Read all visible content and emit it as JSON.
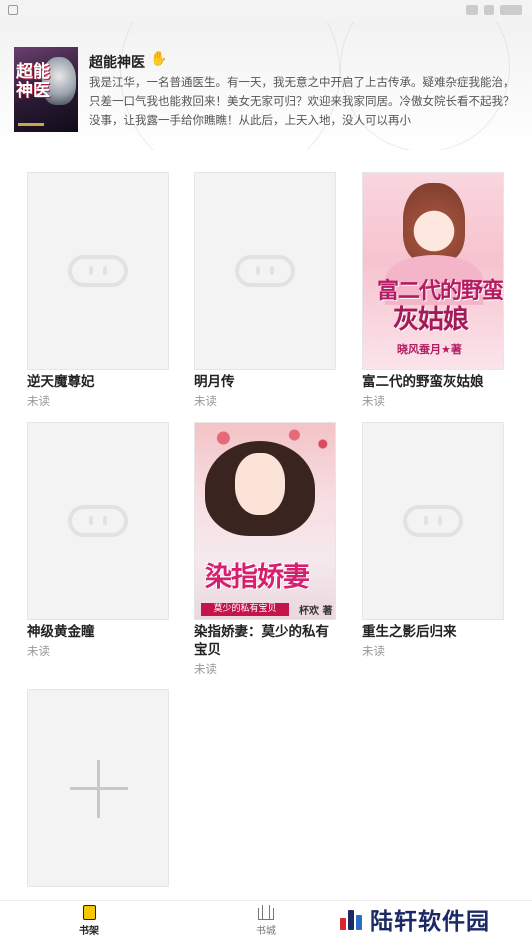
{
  "featured": {
    "title": "超能神医",
    "description": "我是江华，一名普通医生。有一天，我无意之中开启了上古传承。疑难杂症我能治，只差一口气我也能救回来！美女无家可归？欢迎来我家同居。冷傲女院长看不起我？没事，让我露一手给你瞧瞧！从此后，上天入地，没人可以再小",
    "cover_text": "超能神医"
  },
  "books": [
    {
      "title": "逆天魔尊妃",
      "status": "未读"
    },
    {
      "title": "明月传",
      "status": "未读"
    },
    {
      "title": "富二代的野蛮灰姑娘",
      "status": "未读",
      "cover_title_1": "富二代的野蛮",
      "cover_title_2": "灰姑娘",
      "cover_author": "晓风蚕月★著"
    },
    {
      "title": "神级黄金瞳",
      "status": "未读"
    },
    {
      "title": "染指娇妻：莫少的私有宝贝",
      "status": "未读",
      "cover_title": "染指娇妻",
      "cover_subtitle": "莫少的私有宝贝",
      "cover_author": "杯欢 著"
    },
    {
      "title": "重生之影后归来",
      "status": "未读"
    }
  ],
  "tabs": {
    "shelf_label": "书架",
    "store_label": "书城"
  },
  "watermark": {
    "text": "陆轩软件园"
  }
}
